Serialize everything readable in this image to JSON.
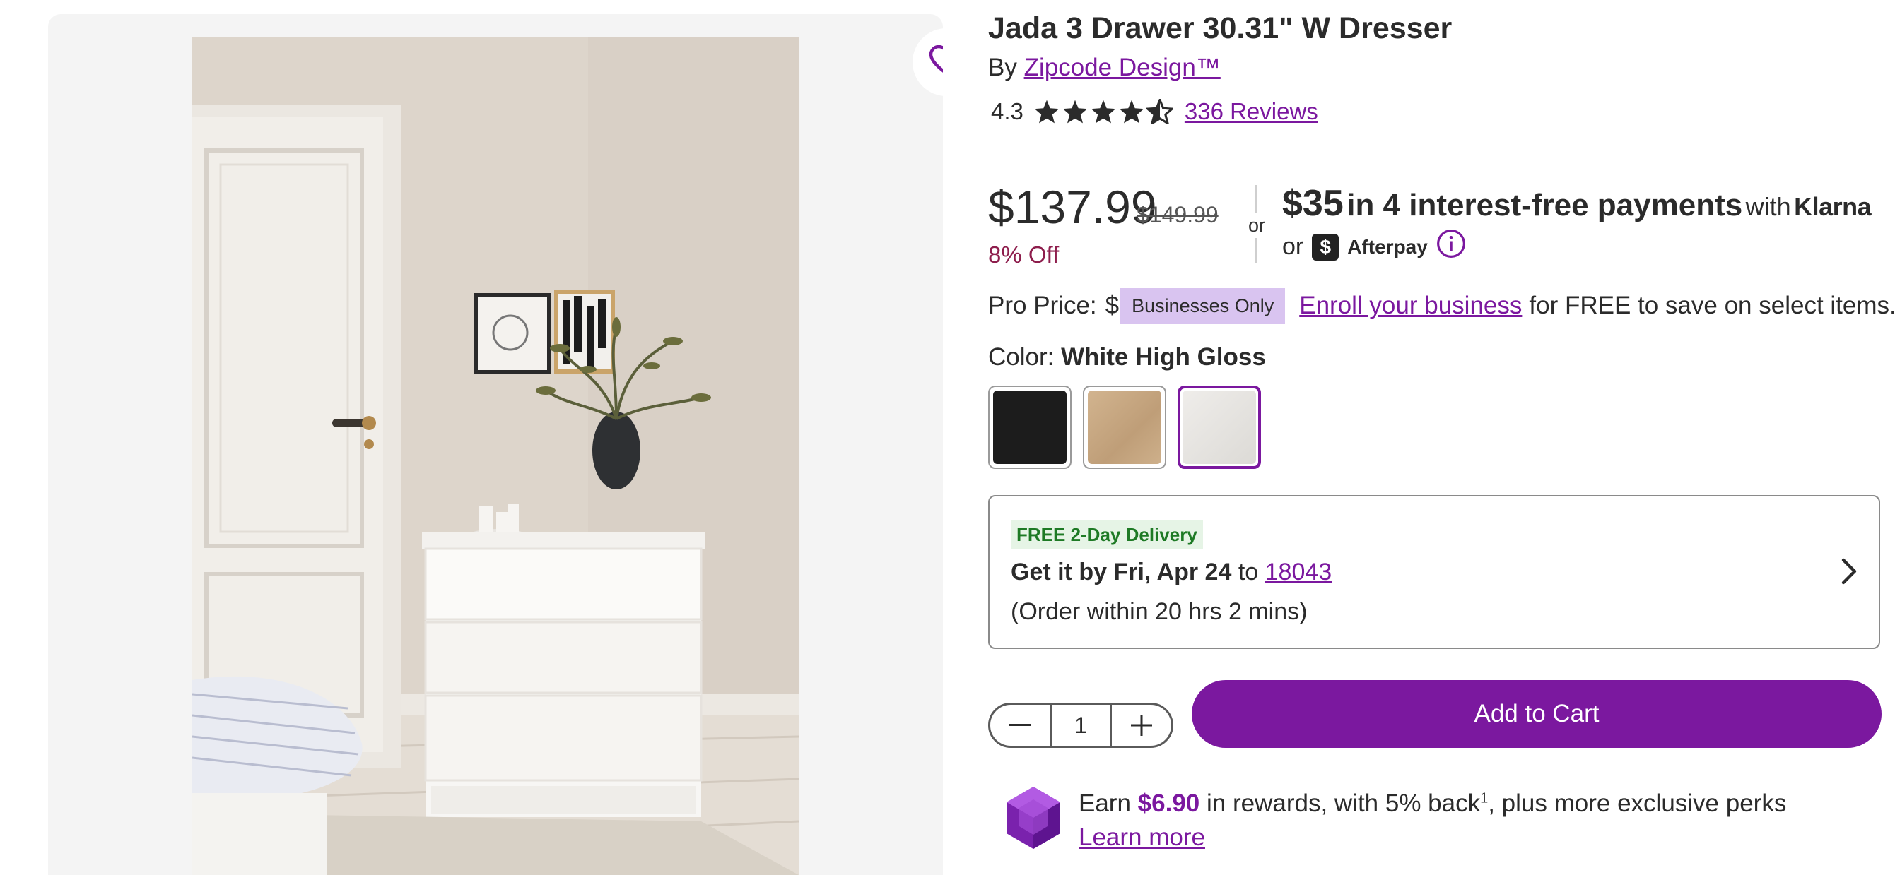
{
  "product": {
    "title": "Jada 3 Drawer 30.31\" W Dresser",
    "by_prefix": "By",
    "brand": "Zipcode Design™",
    "rating": "4.3",
    "rating_stars_value": 4.3,
    "reviews": "336 Reviews"
  },
  "pricing": {
    "price": "$137.99",
    "was_price": "$149.99",
    "discount": "8% Off",
    "or_label": "or",
    "installment_amount": "$35",
    "installment_text": "in 4 interest-free payments",
    "with_label": "with",
    "klarna": "Klarna",
    "or_label_2": "or",
    "afterpay_badge": "$",
    "afterpay": "Afterpay",
    "info_icon": "info-icon"
  },
  "pro": {
    "label": "Pro Price:",
    "masked": "$",
    "badge": "Businesses Only",
    "enroll_link": "Enroll your business",
    "enroll_text": "for FREE to save on select items."
  },
  "color": {
    "label": "Color:",
    "selected": "White High Gloss",
    "swatches": [
      {
        "name": "Black",
        "hex": "#1c1c1c"
      },
      {
        "name": "Natural Oak",
        "hex": "#c9aa86"
      },
      {
        "name": "White High Gloss",
        "hex": "#e6e4e1"
      }
    ]
  },
  "delivery": {
    "badge": "FREE 2-Day Delivery",
    "get_it": "Get it by Fri, Apr 24",
    "to": "to",
    "zip": "18043",
    "order_within": "(Order within 20 hrs 2 mins)"
  },
  "cart": {
    "quantity": "1",
    "add_label": "Add to Cart"
  },
  "rewards": {
    "earn": "Earn",
    "amount": "$6.90",
    "text_a": "in rewards, with 5% back",
    "sup": "1",
    "text_b": ", plus more exclusive perks",
    "learn_more": "Learn more"
  },
  "colors": {
    "accent": "#7b189f",
    "sale": "#8e1e4d",
    "delivery_green": "#1e7a25"
  }
}
